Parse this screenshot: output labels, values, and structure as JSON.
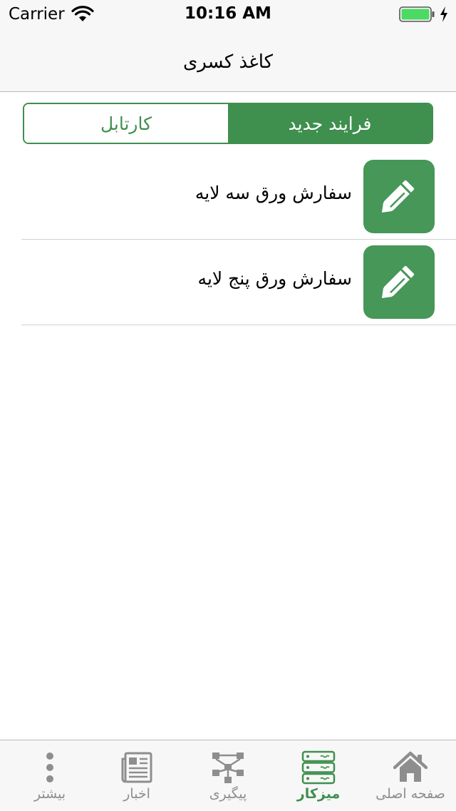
{
  "status_bar": {
    "carrier": "Carrier",
    "time": "10:16 AM",
    "battery_color": "#4cd964"
  },
  "nav": {
    "title": "کاغذ کسری"
  },
  "segmented": {
    "left_label": "کارتابل",
    "right_label": "فرایند جدید",
    "selected": "فرایند جدید",
    "accent_color": "#3f8f4f"
  },
  "list": {
    "items": [
      {
        "label": "سفارش ورق سه لایه",
        "icon": "pencil-icon"
      },
      {
        "label": "سفارش ورق پنج  لایه",
        "icon": "pencil-icon"
      }
    ]
  },
  "tab_bar": {
    "tabs": [
      {
        "label": "بیشتر",
        "icon": "more-icon",
        "active": false
      },
      {
        "label": "اخبار",
        "icon": "newspaper-icon",
        "active": false
      },
      {
        "label": "پیگیری",
        "icon": "workflow-icon",
        "active": false
      },
      {
        "label": "میزکار",
        "icon": "server-icon",
        "active": true
      },
      {
        "label": "صفحه اصلی",
        "icon": "home-icon",
        "active": false
      }
    ]
  }
}
